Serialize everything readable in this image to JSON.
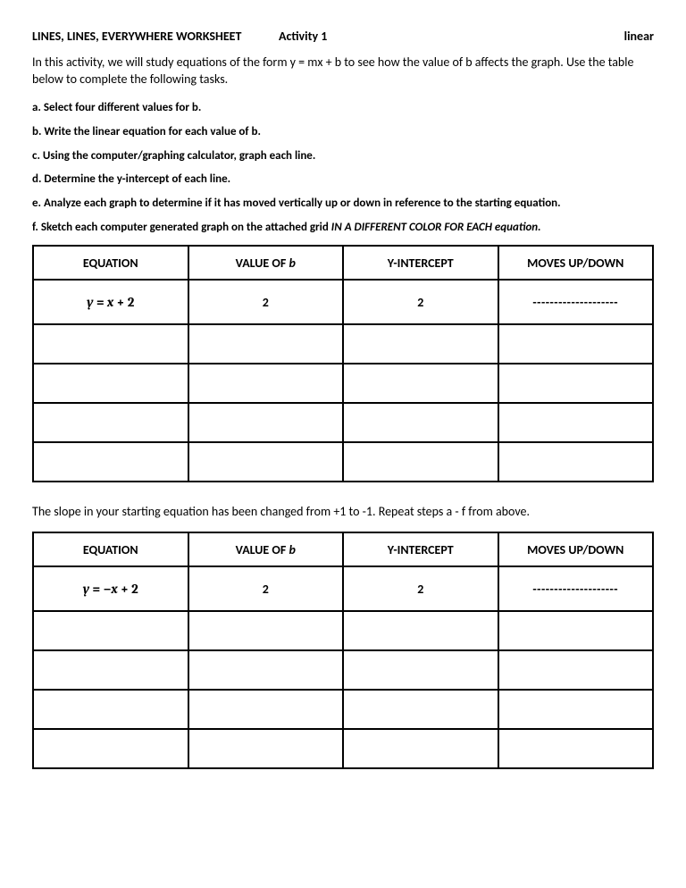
{
  "header": {
    "title_left": "LINES, LINES, EVERYWHERE WORKSHEET",
    "title_mid": "Activity 1",
    "title_right": "linear"
  },
  "intro": "In this activity, we will study equations of the form y = mx + b to see how the value of b affects the graph. Use the table below to complete the following tasks.",
  "tasks": {
    "a": "a. Select four different values for b.",
    "b": "b. Write the linear equation for each value of b.",
    "c": "c. Using the computer/graphing calculator, graph each line.",
    "d": "d. Determine the y-intercept of each line.",
    "e": "e. Analyze each graph to determine if it has moved vertically up or down in reference to the starting equation.",
    "f_prefix": "f. Sketch each computer generated graph on the attached grid ",
    "f_emph": "IN A DIFFERENT COLOR FOR EACH equation."
  },
  "tableHeaders": {
    "equation": "EQUATION",
    "value_b_prefix": "VALUE OF ",
    "value_b_letter": "b",
    "yint": "Y-INTERCEPT",
    "moves": "MOVES UP/DOWN"
  },
  "table1": {
    "row1": {
      "eq_y": "y",
      "eq_eq": " = ",
      "eq_x": "x",
      "eq_plus": " + 2",
      "value_b": "2",
      "yint": "2",
      "moves": "--------------------"
    }
  },
  "midText": "The slope in your starting equation has been changed from +1 to -1. Repeat steps a - f from above.",
  "table2": {
    "row1": {
      "eq_y": "y",
      "eq_eq": " = ",
      "eq_neg": "−",
      "eq_x": "x",
      "eq_plus": " + 2",
      "value_b": "2",
      "yint": "2",
      "moves": "--------------------"
    }
  }
}
